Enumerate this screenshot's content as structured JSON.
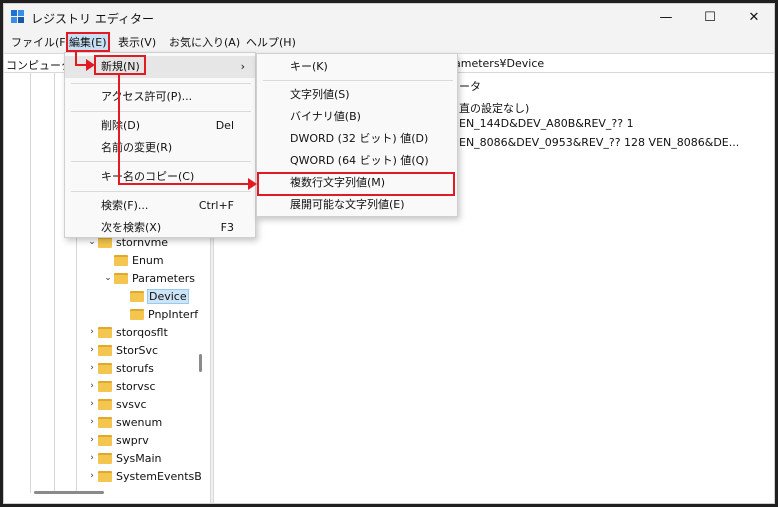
{
  "window": {
    "title": "レジストリ エディター",
    "controls": {
      "minimize": "—",
      "maximize": "☐",
      "close": "✕"
    }
  },
  "menubar": {
    "file": "ファイル(F)",
    "edit": "編集(E)",
    "view": "表示(V)",
    "favorites": "お気に入り(A)",
    "help": "ヘルプ(H)"
  },
  "address": {
    "left": "コンピューター",
    "right": "ameters¥Device"
  },
  "tree": {
    "items": [
      {
        "label": "stornvme",
        "expanded": true,
        "level": 1
      },
      {
        "label": "Enum",
        "expanded": false,
        "level": 2
      },
      {
        "label": "Parameters",
        "expanded": true,
        "level": 2
      },
      {
        "label": "Device",
        "expanded": false,
        "level": 3,
        "selected": true
      },
      {
        "label": "PnpInterf",
        "expanded": false,
        "level": 3
      },
      {
        "label": "storqosflt",
        "expanded": false,
        "level": 1
      },
      {
        "label": "StorSvc",
        "expanded": false,
        "level": 1
      },
      {
        "label": "storufs",
        "expanded": false,
        "level": 1
      },
      {
        "label": "storvsc",
        "expanded": false,
        "level": 1
      },
      {
        "label": "svsvc",
        "expanded": false,
        "level": 1
      },
      {
        "label": "swenum",
        "expanded": false,
        "level": 1
      },
      {
        "label": "swprv",
        "expanded": false,
        "level": 1
      },
      {
        "label": "SysMain",
        "expanded": false,
        "level": 1
      },
      {
        "label": "SystemEventsB",
        "expanded": false,
        "level": 1
      }
    ]
  },
  "list": {
    "header_data": "ータ",
    "row1_data": "直の設定なし)",
    "row2_data": "EN_144D&DEV_A80B&REV_?? 1",
    "row3_data": "EN_8086&DEV_0953&REV_?? 128 VEN_8086&DE..."
  },
  "edit_menu": {
    "new": "新規(N)",
    "permissions": "アクセス許可(P)...",
    "delete": "削除(D)",
    "delete_shortcut": "Del",
    "rename": "名前の変更(R)",
    "copy_key": "キー名のコピー(C)",
    "find": "検索(F)...",
    "find_shortcut": "Ctrl+F",
    "find_next": "次を検索(X)",
    "find_next_shortcut": "F3"
  },
  "new_submenu": {
    "key": "キー(K)",
    "string": "文字列値(S)",
    "binary": "バイナリ値(B)",
    "dword": "DWORD (32 ビット) 値(D)",
    "qword": "QWORD (64 ビット) 値(Q)",
    "multi_string": "複数行文字列値(M)",
    "expandable_string": "展開可能な文字列値(E)"
  },
  "annotation_color": "#e01b24"
}
